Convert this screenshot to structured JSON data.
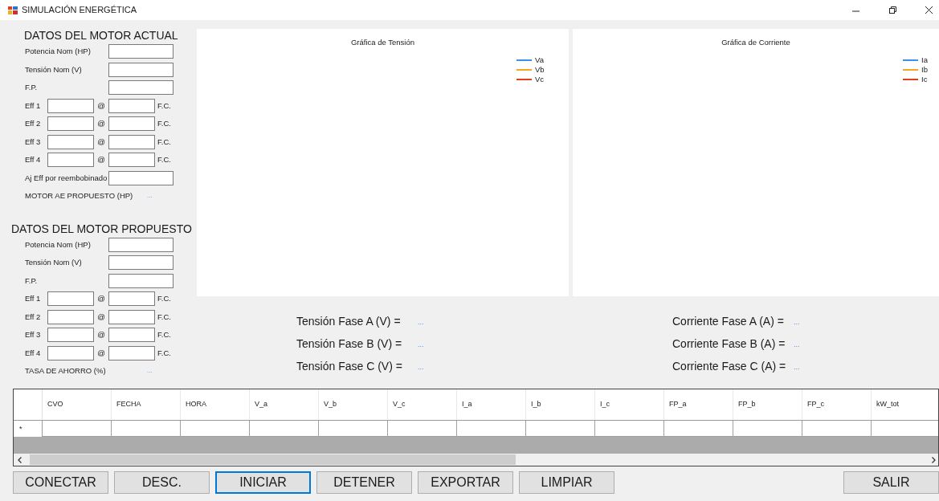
{
  "window": {
    "title": "SIMULACIÓN ENERGÉTICA"
  },
  "sections": [
    {
      "title": "DATOS DEL MOTOR ACTUAL",
      "rows": [
        {
          "kind": "field",
          "label": "Potencia Nom (HP)"
        },
        {
          "kind": "field",
          "label": "Tensión Nom (V)"
        },
        {
          "kind": "field",
          "label": "F.P."
        },
        {
          "kind": "eff",
          "label": "Eff 1",
          "at": "@",
          "unit": "F.C."
        },
        {
          "kind": "eff",
          "label": "Eff 2",
          "at": "@",
          "unit": "F.C."
        },
        {
          "kind": "eff",
          "label": "Eff 3",
          "at": "@",
          "unit": "F.C."
        },
        {
          "kind": "eff",
          "label": "Eff 4",
          "at": "@",
          "unit": "F.C."
        },
        {
          "kind": "field",
          "label": "Aj Eff por reembobinado"
        },
        {
          "kind": "readout",
          "label": "MOTOR AE PROPUESTO (HP)",
          "value": "..."
        }
      ]
    },
    {
      "title": "DATOS DEL MOTOR PROPUESTO",
      "rows": [
        {
          "kind": "field",
          "label": "Potencia Nom (HP)"
        },
        {
          "kind": "field",
          "label": "Tensión Nom (V)"
        },
        {
          "kind": "field",
          "label": "F.P."
        },
        {
          "kind": "eff",
          "label": "Eff 1",
          "at": "@",
          "unit": "F.C."
        },
        {
          "kind": "eff",
          "label": "Eff 2",
          "at": "@",
          "unit": "F.C."
        },
        {
          "kind": "eff",
          "label": "Eff 3",
          "at": "@",
          "unit": "F.C."
        },
        {
          "kind": "eff",
          "label": "Eff 4",
          "at": "@",
          "unit": "F.C."
        },
        {
          "kind": "readout",
          "label": "TASA DE AHORRO (%)",
          "value": "..."
        }
      ]
    }
  ],
  "charts": [
    {
      "title": "Gráfica de Tensión",
      "legend": [
        {
          "label": "Va",
          "color": "#3c8ff0"
        },
        {
          "label": "Vb",
          "color": "#f5a623"
        },
        {
          "label": "Vc",
          "color": "#e0401a"
        }
      ]
    },
    {
      "title": "Gráfica de Corriente",
      "legend": [
        {
          "label": "Ia",
          "color": "#3c8ff0"
        },
        {
          "label": "Ib",
          "color": "#f5a623"
        },
        {
          "label": "Ic",
          "color": "#e0401a"
        }
      ]
    }
  ],
  "voltage_readouts": [
    {
      "label": "Tensión Fase A (V) =",
      "value": "..."
    },
    {
      "label": "Tensión Fase B (V) =",
      "value": "..."
    },
    {
      "label": "Tensión Fase C (V) =",
      "value": "..."
    }
  ],
  "current_readouts": [
    {
      "label": "Corriente Fase A (A) =",
      "value": "..."
    },
    {
      "label": "Corriente Fase B (A) =",
      "value": "..."
    },
    {
      "label": "Corriente Fase C (A) =",
      "value": "..."
    }
  ],
  "table": {
    "columns": [
      "CVO",
      "FECHA",
      "HORA",
      "V_a",
      "V_b",
      "V_c",
      "I_a",
      "I_b",
      "I_c",
      "FP_a",
      "FP_b",
      "FP_c",
      "kW_tot"
    ],
    "rows": [
      {
        "marker": "*"
      }
    ]
  },
  "buttons": [
    {
      "label": "CONECTAR",
      "focused": false
    },
    {
      "label": "DESC.",
      "focused": false
    },
    {
      "label": "INICIAR",
      "focused": true
    },
    {
      "label": "DETENER",
      "focused": false
    },
    {
      "label": "EXPORTAR",
      "focused": false
    },
    {
      "label": "LIMPIAR",
      "focused": false
    }
  ],
  "exit_button": {
    "label": "SALIR",
    "focused": false
  }
}
